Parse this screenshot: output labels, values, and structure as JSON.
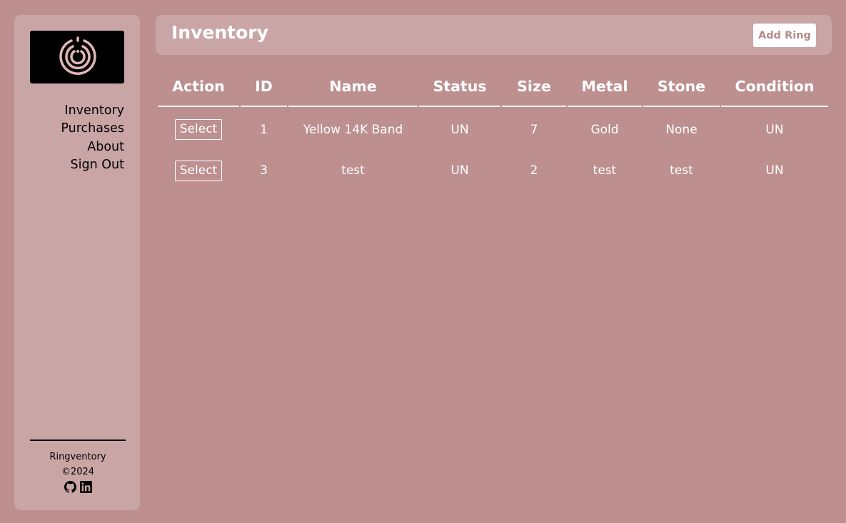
{
  "sidebar": {
    "nav": [
      "Inventory",
      "Purchases",
      "About",
      "Sign Out"
    ],
    "footer": {
      "brand": "Ringventory",
      "copyright": "©2024",
      "social": [
        "github-icon",
        "linkedin-icon"
      ]
    }
  },
  "header": {
    "title": "Inventory",
    "add_label": "Add Ring"
  },
  "table": {
    "columns": [
      "Action",
      "ID",
      "Name",
      "Status",
      "Size",
      "Metal",
      "Stone",
      "Condition"
    ],
    "rows": [
      {
        "action": "Select",
        "id": "1",
        "name": "Yellow 14K Band",
        "status": "UN",
        "size": "7",
        "metal": "Gold",
        "stone": "None",
        "condition": "UN"
      },
      {
        "action": "Select",
        "id": "3",
        "name": "test",
        "status": "UN",
        "size": "2",
        "metal": "test",
        "stone": "test",
        "condition": "UN"
      }
    ]
  },
  "colors": {
    "background": "#bd8f8f",
    "panel": "#c9a5a5",
    "accent_text": "#b68b8b"
  }
}
